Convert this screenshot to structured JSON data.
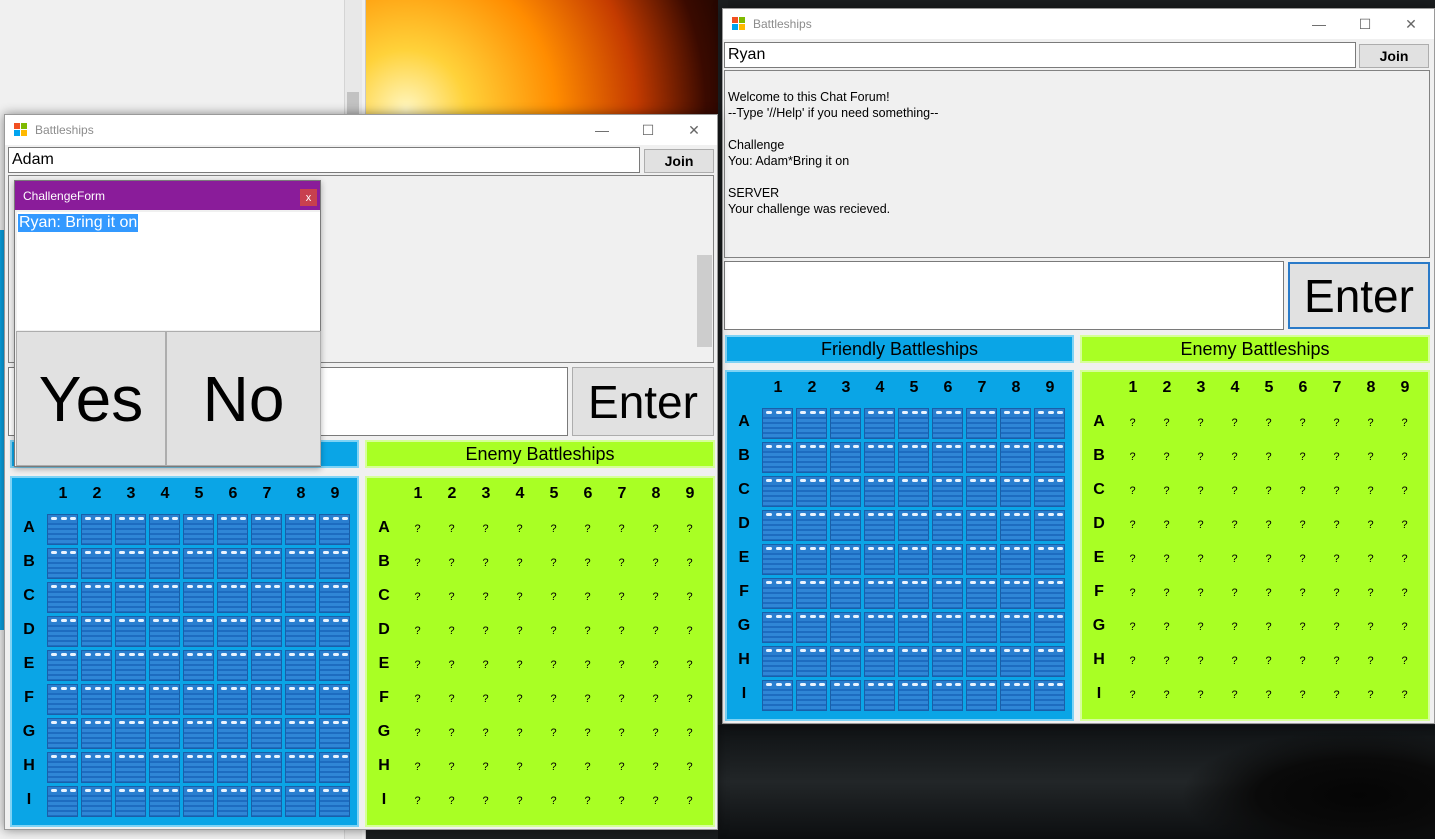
{
  "colors": {
    "friendly": "#0aa5e6",
    "enemy": "#a9ff24",
    "challenge_title": "#8a1c9a",
    "close_red": "#c8404e",
    "selection": "#3399ff"
  },
  "grid": {
    "columns": [
      "1",
      "2",
      "3",
      "4",
      "5",
      "6",
      "7",
      "8",
      "9"
    ],
    "rows": [
      "A",
      "B",
      "C",
      "D",
      "E",
      "F",
      "G",
      "H",
      "I"
    ],
    "unknown_marker": "?"
  },
  "window_left": {
    "title": "Battleships",
    "name_value": "Adam",
    "join_label": "Join",
    "enter_label": "Enter",
    "enemy_label": "Enemy Battleships"
  },
  "window_right": {
    "title": "Battleships",
    "name_value": "Ryan",
    "join_label": "Join",
    "enter_label": "Enter",
    "friendly_label": "Friendly Battleships",
    "enemy_label": "Enemy Battleships",
    "chat_lines": [
      "Welcome to this Chat Forum!",
      "--Type '//Help' if you need something--",
      "",
      "Challenge",
      "You: Adam*Bring it on",
      "",
      "SERVER",
      "Your challenge was recieved."
    ]
  },
  "challenge_form": {
    "title": "ChallengeForm",
    "close_label": "x",
    "message": "Ryan: Bring it on",
    "yes_label": "Yes",
    "no_label": "No"
  },
  "icons": {
    "window_controls": [
      "minimize-icon",
      "maximize-icon",
      "close-icon"
    ],
    "app": "battleships-app-icon",
    "water": "water-tile-icon"
  }
}
